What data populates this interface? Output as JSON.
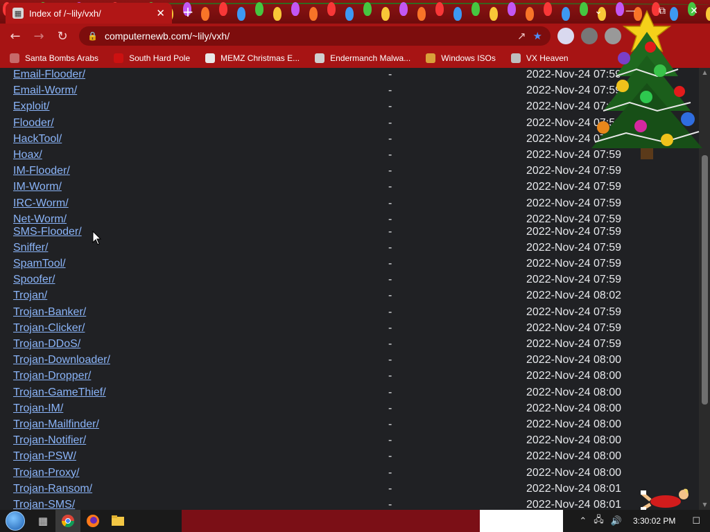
{
  "browser": {
    "tab_title": "Index of /~lily/vxh/",
    "url": "computernewb.com/~lily/vxh/",
    "icons": {
      "tab_favicon": "folder-icon",
      "close_tab": "close-icon",
      "new_tab": "plus-icon",
      "back": "arrow-left-icon",
      "forward": "arrow-right-icon",
      "reload": "reload-icon",
      "lock": "lock-icon",
      "share": "share-icon",
      "bookmark_star": "star-icon"
    }
  },
  "bookmarks": [
    {
      "label": "Santa Bombs Arabs",
      "color": "#c76a6a"
    },
    {
      "label": "South Hard Pole",
      "color": "#c11"
    },
    {
      "label": "MEMZ Christmas E...",
      "color": "#e8e8e8"
    },
    {
      "label": "Endermanch Malwa...",
      "color": "#cfcfcf"
    },
    {
      "label": "Windows ISOs",
      "color": "#d9a03a"
    },
    {
      "label": "VX Heaven",
      "color": "#bfbfbf"
    }
  ],
  "listing": [
    {
      "name": "Email-Flooder/",
      "size": "-",
      "date": "2022-Nov-24 07:59"
    },
    {
      "name": "Email-Worm/",
      "size": "-",
      "date": "2022-Nov-24 07:59"
    },
    {
      "name": "Exploit/",
      "size": "-",
      "date": "2022-Nov-24 07:59"
    },
    {
      "name": "Flooder/",
      "size": "-",
      "date": "2022-Nov-24 07:59"
    },
    {
      "name": "HackTool/",
      "size": "-",
      "date": "2022-Nov-24 07:59"
    },
    {
      "name": "Hoax/",
      "size": "-",
      "date": "2022-Nov-24 07:59"
    },
    {
      "name": "IM-Flooder/",
      "size": "-",
      "date": "2022-Nov-24 07:59"
    },
    {
      "name": "IM-Worm/",
      "size": "-",
      "date": "2022-Nov-24 07:59"
    },
    {
      "name": "IRC-Worm/",
      "size": "-",
      "date": "2022-Nov-24 07:59"
    },
    {
      "name": "Net-Worm/",
      "size": "-",
      "date": "2022-Nov-24 07:59"
    },
    {
      "name": "SMS-Flooder/",
      "size": "-",
      "date": "2022-Nov-24 07:59"
    },
    {
      "name": "Sniffer/",
      "size": "-",
      "date": "2022-Nov-24 07:59"
    },
    {
      "name": "SpamTool/",
      "size": "-",
      "date": "2022-Nov-24 07:59"
    },
    {
      "name": "Spoofer/",
      "size": "-",
      "date": "2022-Nov-24 07:59"
    },
    {
      "name": "Trojan/",
      "size": "-",
      "date": "2022-Nov-24 08:02"
    },
    {
      "name": "Trojan-Banker/",
      "size": "-",
      "date": "2022-Nov-24 07:59"
    },
    {
      "name": "Trojan-Clicker/",
      "size": "-",
      "date": "2022-Nov-24 07:59"
    },
    {
      "name": "Trojan-DDoS/",
      "size": "-",
      "date": "2022-Nov-24 07:59"
    },
    {
      "name": "Trojan-Downloader/",
      "size": "-",
      "date": "2022-Nov-24 08:00"
    },
    {
      "name": "Trojan-Dropper/",
      "size": "-",
      "date": "2022-Nov-24 08:00"
    },
    {
      "name": "Trojan-GameThief/",
      "size": "-",
      "date": "2022-Nov-24 08:00"
    },
    {
      "name": "Trojan-IM/",
      "size": "-",
      "date": "2022-Nov-24 08:00"
    },
    {
      "name": "Trojan-Mailfinder/",
      "size": "-",
      "date": "2022-Nov-24 08:00"
    },
    {
      "name": "Trojan-Notifier/",
      "size": "-",
      "date": "2022-Nov-24 08:00"
    },
    {
      "name": "Trojan-PSW/",
      "size": "-",
      "date": "2022-Nov-24 08:00"
    },
    {
      "name": "Trojan-Proxy/",
      "size": "-",
      "date": "2022-Nov-24 08:00"
    },
    {
      "name": "Trojan-Ransom/",
      "size": "-",
      "date": "2022-Nov-24 08:01"
    },
    {
      "name": "Trojan-SMS/",
      "size": "-",
      "date": "2022-Nov-24 08:01"
    }
  ],
  "taskbar": {
    "clock": "3:30:02 PM",
    "apps": [
      "chrome-icon",
      "firefox-icon",
      "folder-icon",
      "task-view-icon"
    ]
  },
  "colors": {
    "theme_red": "#a71414",
    "page_bg": "#202124",
    "link": "#8ab4f8"
  }
}
